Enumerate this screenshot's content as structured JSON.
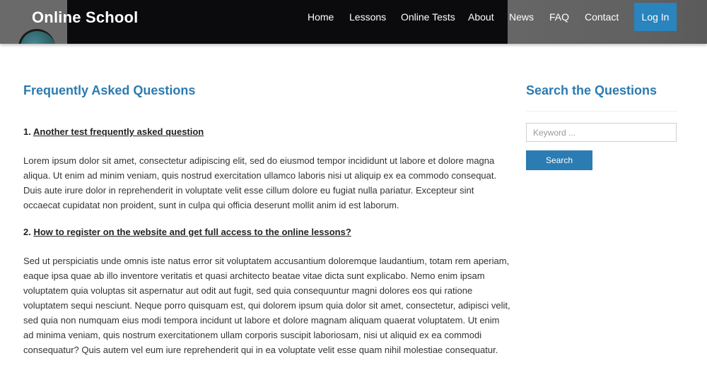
{
  "header": {
    "logo": "Online School",
    "nav": [
      {
        "label": "Home"
      },
      {
        "label": "Lessons"
      },
      {
        "label": "Online Tests"
      },
      {
        "label": "About"
      },
      {
        "label": "News"
      },
      {
        "label": "FAQ"
      },
      {
        "label": "Contact"
      }
    ],
    "login_label": "Log In"
  },
  "main": {
    "title": "Frequently Asked Questions",
    "faqs": [
      {
        "number": "1.",
        "question": "Another test frequently asked question",
        "answer": "Lorem ipsum dolor sit amet, consectetur adipiscing elit, sed do eiusmod tempor incididunt ut labore et dolore magna aliqua. Ut enim ad minim veniam, quis nostrud exercitation ullamco laboris nisi ut aliquip ex ea commodo consequat. Duis aute irure dolor in reprehenderit in voluptate velit esse cillum dolore eu fugiat nulla pariatur. Excepteur sint occaecat cupidatat non proident, sunt in culpa qui officia deserunt mollit anim id est laborum."
      },
      {
        "number": "2.",
        "question": "How to register on the website and get full access to the online lessons?",
        "answer": "Sed ut perspiciatis unde omnis iste natus error sit voluptatem accusantium doloremque laudantium, totam rem aperiam, eaque ipsa quae ab illo inventore veritatis et quasi architecto beatae vitae dicta sunt explicabo. Nemo enim ipsam voluptatem quia voluptas sit aspernatur aut odit aut fugit, sed quia consequuntur magni dolores eos qui ratione voluptatem sequi nesciunt. Neque porro quisquam est, qui dolorem ipsum quia dolor sit amet, consectetur, adipisci velit, sed quia non numquam eius modi tempora incidunt ut labore et dolore magnam aliquam quaerat voluptatem. Ut enim ad minima veniam, quis nostrum exercitationem ullam corporis suscipit laboriosam, nisi ut aliquid ex ea commodi consequatur? Quis autem vel eum iure reprehenderit qui in ea voluptate velit esse quam nihil molestiae consequatur."
      }
    ]
  },
  "sidebar": {
    "title": "Search the Questions",
    "search": {
      "placeholder": "Keyword ...",
      "value": ""
    },
    "search_button": "Search"
  },
  "colors": {
    "accent": "#2b7bb0",
    "button": "#2a84bd",
    "header_dark": "#0b0b0d",
    "header_gray": "#626262"
  }
}
